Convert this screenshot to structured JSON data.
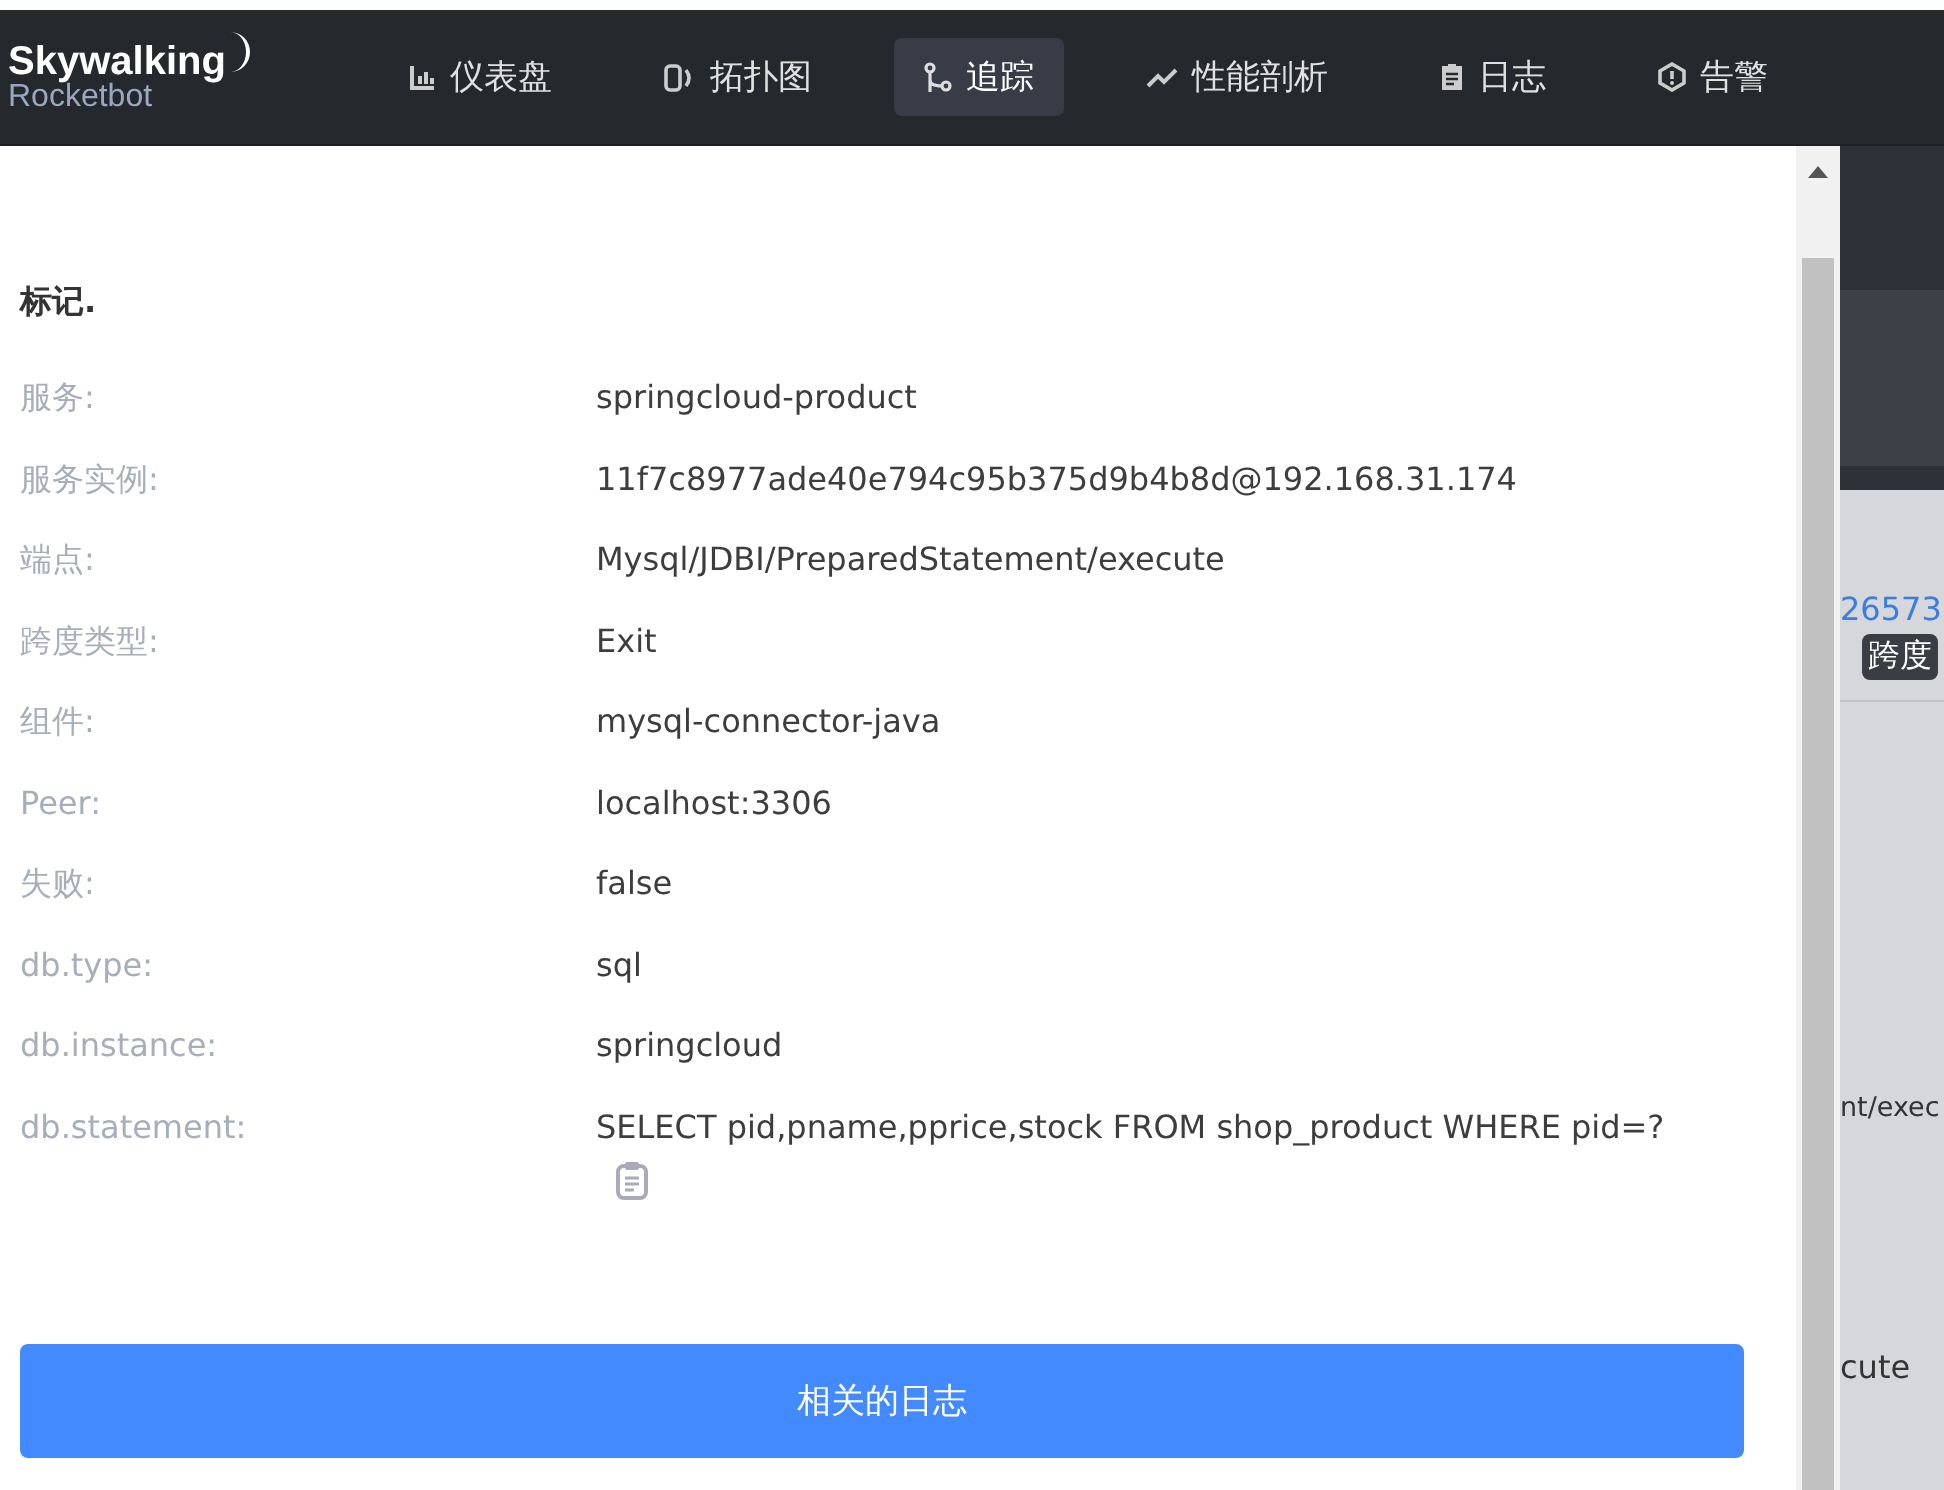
{
  "header": {
    "logo_title": "Skywalking",
    "logo_subtitle": "Rocketbot",
    "nav": [
      {
        "label": "仪表盘",
        "selected": false
      },
      {
        "label": "拓扑图",
        "selected": false
      },
      {
        "label": "追踪",
        "selected": true
      },
      {
        "label": "性能剖析",
        "selected": false
      },
      {
        "label": "日志",
        "selected": false
      },
      {
        "label": "告警",
        "selected": false
      }
    ]
  },
  "panel": {
    "title": "标记.",
    "rows": [
      {
        "label": "服务:",
        "value": "springcloud-product",
        "kind": "plain"
      },
      {
        "label": "服务实例:",
        "value": "11f7c8977ade40e794c95b375d9b4b8d@192.168.31.174",
        "kind": "plain"
      },
      {
        "label": "端点:",
        "value": "Mysql/JDBI/PreparedStatement/execute",
        "kind": "plain"
      },
      {
        "label": "跨度类型:",
        "value": "Exit",
        "kind": "plain"
      },
      {
        "label": "组件:",
        "value": "mysql-connector-java",
        "kind": "plain"
      },
      {
        "label": "Peer:",
        "value": "localhost:3306",
        "kind": "plain"
      },
      {
        "label": "失败:",
        "value": "false",
        "kind": "plain"
      },
      {
        "label": "db.type:",
        "value": "sql",
        "kind": "plain"
      },
      {
        "label": "db.instance:",
        "value": "springcloud",
        "kind": "plain"
      },
      {
        "label": "db.statement:",
        "value": "SELECT pid,pname,pprice,stock FROM shop_product WHERE pid=?",
        "kind": "copyable"
      }
    ],
    "button": "相关的日志"
  },
  "background": {
    "link": "26573",
    "badge": "跨度",
    "text_1": "nt/exec",
    "text_2": "cute"
  }
}
